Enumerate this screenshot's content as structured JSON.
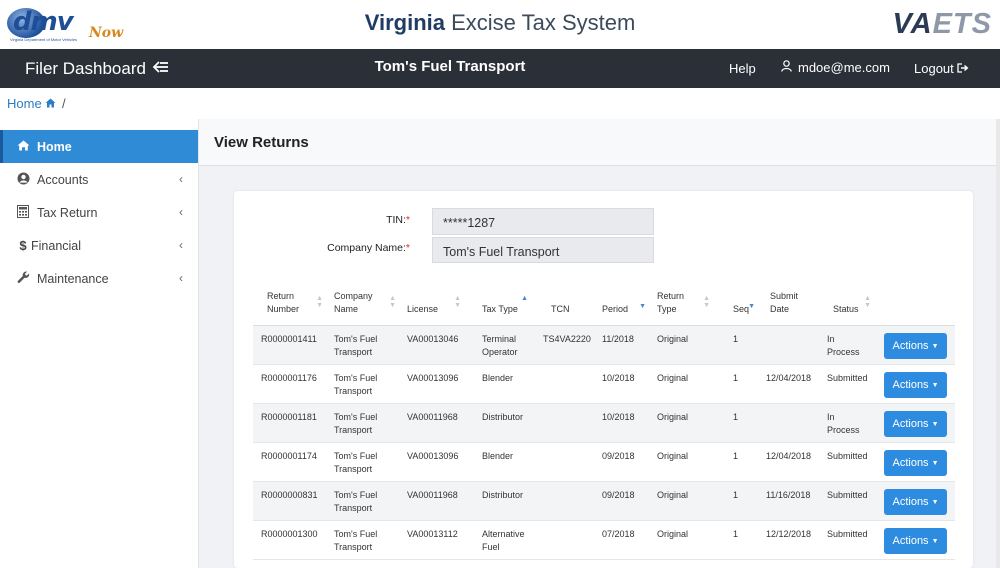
{
  "brand": {
    "dmv_logo_text": "dmv",
    "dmv_logo_now": "Now",
    "dmv_logo_sub": "Virginia Department of Motor Vehicles",
    "title_bold": "Virginia",
    "title_rest": " Excise Tax System",
    "vaets_main": "VA",
    "vaets_accent": "ETS"
  },
  "navbar": {
    "title": "Filer Dashboard",
    "toggle_icon": "arrow-left-icon",
    "company": "Tom's Fuel Transport",
    "help": "Help",
    "user": "mdoe@me.com",
    "logout": "Logout"
  },
  "breadcrumb": {
    "home": "Home",
    "separator": "/"
  },
  "sidebar": {
    "items": [
      {
        "label": "Home",
        "icon": "home-icon",
        "active": true
      },
      {
        "label": "Accounts",
        "icon": "user-circle-icon"
      },
      {
        "label": "Tax Return",
        "icon": "calculator-icon"
      },
      {
        "label": "Financial",
        "icon": "dollar-icon"
      },
      {
        "label": "Maintenance",
        "icon": "wrench-icon"
      }
    ]
  },
  "page": {
    "title": "View Returns"
  },
  "form": {
    "tin_label": "TIN:",
    "tin_value": "*****1287",
    "company_label": "Company Name:",
    "company_value": "Tom's Fuel Transport",
    "required_mark": "*"
  },
  "table": {
    "headers": [
      "Return Number",
      "Company Name",
      "License",
      "Tax Type",
      "TCN",
      "Period",
      "Return Type",
      "Seq",
      "Submit Date",
      "Status"
    ],
    "action_label": "Actions",
    "rows": [
      {
        "return_number": "R0000001411",
        "company": "Tom's Fuel Transport",
        "license": "VA00013046",
        "tax_type": "Terminal Operator",
        "tcn": "TS4VA2220",
        "period": "11/2018",
        "return_type": "Original",
        "seq": "1",
        "submit_date": "",
        "status": "In Process"
      },
      {
        "return_number": "R0000001176",
        "company": "Tom's Fuel Transport",
        "license": "VA00013096",
        "tax_type": "Blender",
        "tcn": "",
        "period": "10/2018",
        "return_type": "Original",
        "seq": "1",
        "submit_date": "12/04/2018",
        "status": "Submitted"
      },
      {
        "return_number": "R0000001181",
        "company": "Tom's Fuel Transport",
        "license": "VA00011968",
        "tax_type": "Distributor",
        "tcn": "",
        "period": "10/2018",
        "return_type": "Original",
        "seq": "1",
        "submit_date": "",
        "status": "In Process"
      },
      {
        "return_number": "R0000001174",
        "company": "Tom's Fuel Transport",
        "license": "VA00013096",
        "tax_type": "Blender",
        "tcn": "",
        "period": "09/2018",
        "return_type": "Original",
        "seq": "1",
        "submit_date": "12/04/2018",
        "status": "Submitted"
      },
      {
        "return_number": "R0000000831",
        "company": "Tom's Fuel Transport",
        "license": "VA00011968",
        "tax_type": "Distributor",
        "tcn": "",
        "period": "09/2018",
        "return_type": "Original",
        "seq": "1",
        "submit_date": "11/16/2018",
        "status": "Submitted"
      },
      {
        "return_number": "R0000001300",
        "company": "Tom's Fuel Transport",
        "license": "VA00013112",
        "tax_type": "Alternative Fuel",
        "tcn": "",
        "period": "07/2018",
        "return_type": "Original",
        "seq": "1",
        "submit_date": "12/12/2018",
        "status": "Submitted"
      }
    ]
  },
  "colors": {
    "navbar": "#2b2f38",
    "accent": "#2f8bd5",
    "button": "#2d8cdf",
    "required": "#d32f2f"
  }
}
